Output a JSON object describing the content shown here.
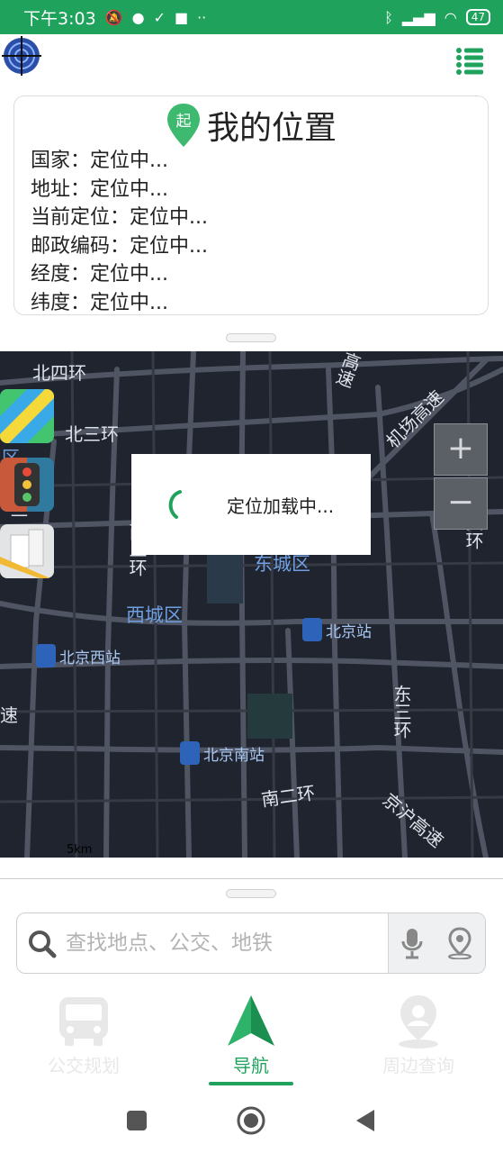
{
  "status_bar": {
    "time": "下午3:03",
    "battery": "47"
  },
  "location_card": {
    "pin_label": "起",
    "title": "我的位置",
    "lines": [
      "国家：定位中...",
      "地址：定位中...",
      "当前定位：定位中...",
      "邮政编码：定位中...",
      "经度：定位中...",
      "纬度：定位中..."
    ]
  },
  "map": {
    "roads": {
      "north_4th_ring": "北四环",
      "north_3rd_ring": "北三环",
      "west_2nd_ring": "西二环",
      "west_3rd_ring_fragment": "西三",
      "district_fragment": "区",
      "airport_expressway": "机场高速",
      "expressway_fragment_top": "高速",
      "east_4th_ring": "东四环",
      "east_3rd_ring": "东三环",
      "south_2nd_ring": "南二环",
      "jinghu_expressway": "京沪高速",
      "expressway_fragment_left": "速"
    },
    "districts": {
      "dongcheng": "东城区",
      "xicheng": "西城区"
    },
    "stations": {
      "beijing": "北京站",
      "beijing_west": "北京西站",
      "beijing_south": "北京南站"
    },
    "zoom_in": "+",
    "zoom_out": "−",
    "scale": "5km",
    "loading_text": "定位加载中..."
  },
  "search": {
    "placeholder": "查找地点、公交、地铁"
  },
  "tabs": [
    {
      "label": "公交规划",
      "active": false
    },
    {
      "label": "导航",
      "active": true
    },
    {
      "label": "周边查询",
      "active": false
    }
  ],
  "colors": {
    "accent": "#1fa35c",
    "map_bg": "#20242f",
    "inactive_tab": "#e8e8e8"
  }
}
